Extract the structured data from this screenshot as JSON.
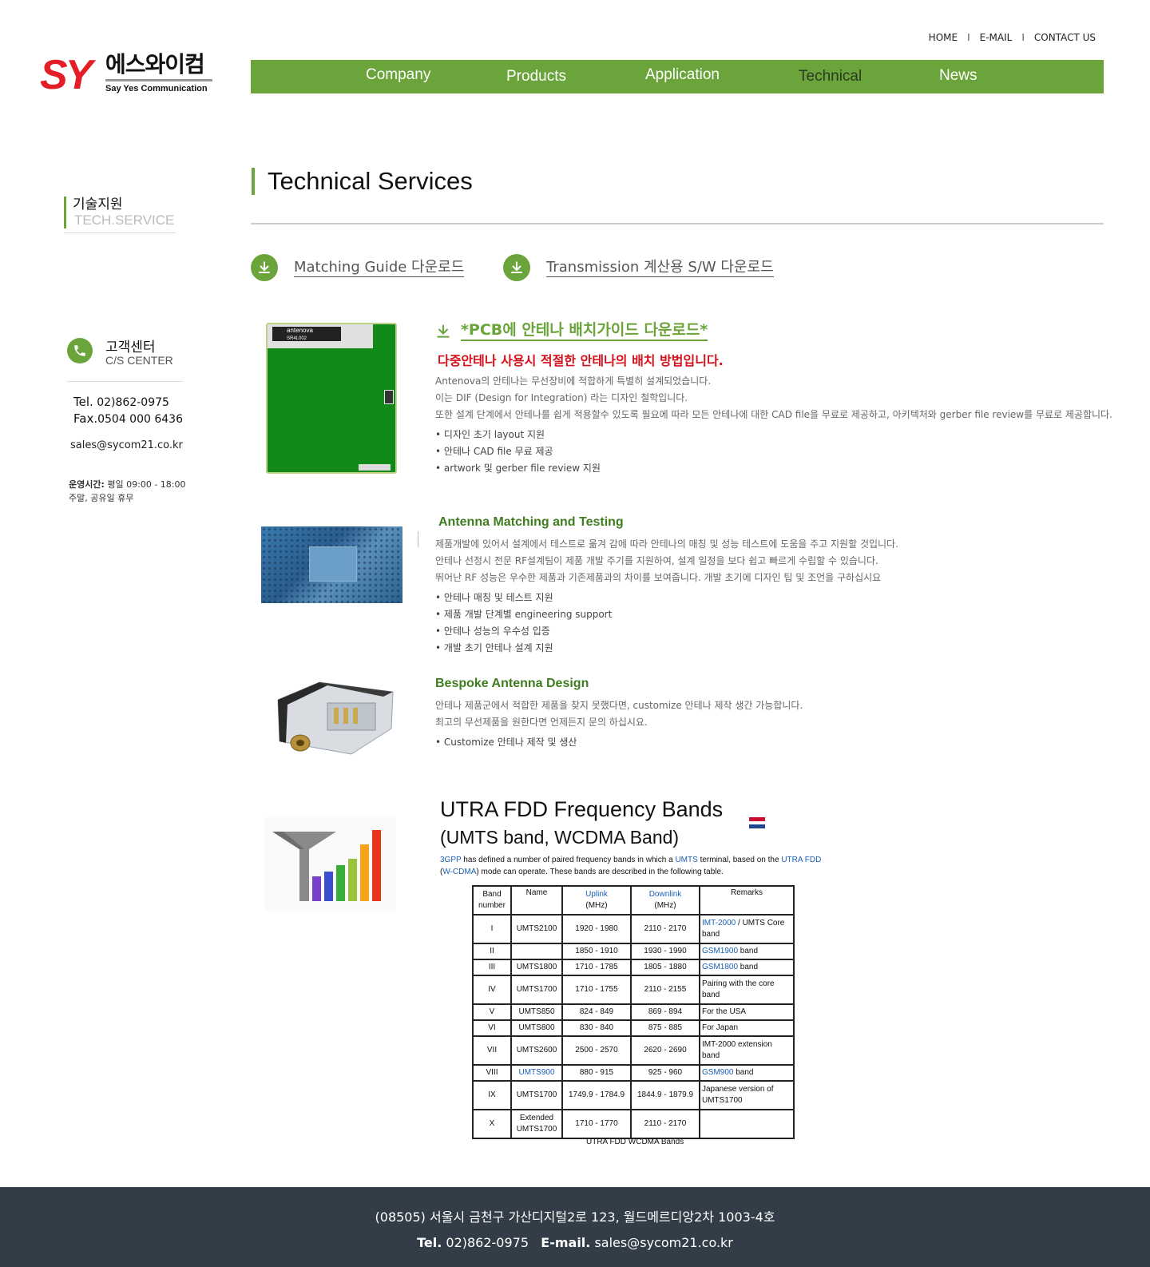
{
  "top_links": [
    "HOME",
    "E-MAIL",
    "CONTACT US"
  ],
  "top_links_sep": "I",
  "logo": {
    "mark": "SY",
    "korean": "에스와이컴",
    "english": "Say Yes Communication"
  },
  "nav": [
    "Company",
    "Products",
    "Application",
    "Technical",
    "News"
  ],
  "nav_active": "Technical",
  "colors": {
    "accent": "#6aa43a",
    "red": "#d4101a",
    "brand_red": "#e41e26",
    "footer": "#333d48"
  },
  "sidebar": {
    "title_ko": "기술지원",
    "title_en": "TECH.SERVICE",
    "cs_ko": "고객센터",
    "cs_en": "C/S CENTER",
    "tel_label": "Tel.",
    "tel": " 02)862-0975",
    "fax_label": "Fax.",
    "fax": "0504 000 6436",
    "email": "sales@sycom21.co.kr",
    "hours_label": "운영시간:",
    "hours": " 평일 09:00 - 18:00",
    "holiday": "주말, 공유일 휴무"
  },
  "page_title": "Technical Services",
  "downloads": [
    "Matching Guide 다운로드",
    "Transmission 계산용 S/W 다운로드"
  ],
  "pcb": {
    "chip_label": "antenova",
    "chip_sub": "SR4L002",
    "link": "*PCB에 안테나 배치가이드 다운로드*",
    "red": "다중안테나 사용시 적절한 안테나의 배치 방법입니다.",
    "paras": [
      "Antenova의 안테나는 무선장비에 적합하게 특별히 설계되었습니다.",
      "이는 DIF (Design for Integration) 라는 디자인 철학입니다.",
      "또한 설계 단계에서 안테나를 쉽게 적용할수 있도록 필요에 따라 모든 안테나에 대한 CAD file을 무료로 제공하고, 아키텍처와 gerber file review를 무료로 제공합니다."
    ],
    "bullets": [
      "디자인 초기 layout 지원",
      "안테나 CAD file 무료 제공",
      "artwork 및 gerber file review 지원"
    ]
  },
  "matching": {
    "title": "Antenna Matching and Testing",
    "paras": [
      "제품개발에 있어서 설계에서 테스트로 옮겨 감에 따라 안테나의 매칭 및 성능 테스트에 도움을 주고 지원할 것입니다.",
      "안테나 선정시 전문 RF설계팀이 제품 개발 주기를 지원하여, 설계 일정을 보다 쉽고 빠르게 수립할 수 있습니다.",
      "뛰어난 RF 성능은 우수한 제품과 기존제품과의 차이를 보여줍니다. 개발 초기에 디자인 팁 및 조언을 구하십시요"
    ],
    "bullets": [
      "안테나 매칭 및 테스트 지원",
      "제품 개발 단계별 engineering support",
      "안테나 성능의 우수성 입증",
      "개발 초기 안테나 설계 지원"
    ]
  },
  "bespoke": {
    "title": "Bespoke Antenna Design",
    "paras": [
      "안테나 제품군에서 적합한 제품을 찾지 못했다면, customize 안테나 제작 생간 가능합니다.",
      "최고의 무선제품을 원한다면 언제든지 문의 하십시요."
    ],
    "bullets": [
      "Customize 안테나 제작 및 생산"
    ]
  },
  "utra": {
    "title1": "UTRA FDD Frequency Bands",
    "title2": "(UMTS band, WCDMA Band)",
    "desc_parts": [
      "3GPP",
      " has defined a number of paired frequency bands in which a ",
      "UMTS",
      " terminal, based on the ",
      "UTRA FDD",
      " (",
      "W-CDMA",
      ") mode can operate. These bands are described in the following table."
    ],
    "headers": [
      "Band number",
      "Name",
      "Uplink",
      "(MHz)",
      "Downlink",
      "(MHz)",
      "Remarks"
    ],
    "rows": [
      {
        "band": "I",
        "name": "UMTS2100",
        "up": "1920 - 1980",
        "down": "2110 - 2170",
        "rem_link": "IMT-2000",
        "rem": " / UMTS Core band"
      },
      {
        "band": "II",
        "name": "",
        "up": "1850 - 1910",
        "down": "1930 - 1990",
        "rem_link": "GSM1900",
        "rem": " band"
      },
      {
        "band": "III",
        "name": "UMTS1800",
        "up": "1710 - 1785",
        "down": "1805 - 1880",
        "rem_link": "GSM1800",
        "rem": " band"
      },
      {
        "band": "IV",
        "name": "UMTS1700",
        "up": "1710 - 1755",
        "down": "2110 - 2155",
        "rem_link": "",
        "rem": "Pairing with the core band"
      },
      {
        "band": "V",
        "name": "UMTS850",
        "up": "824 - 849",
        "down": "869 - 894",
        "rem_link": "",
        "rem": "For the USA"
      },
      {
        "band": "VI",
        "name": "UMTS800",
        "up": "830 - 840",
        "down": "875 - 885",
        "rem_link": "",
        "rem": "For Japan"
      },
      {
        "band": "VII",
        "name": "UMTS2600",
        "up": "2500 - 2570",
        "down": "2620 - 2690",
        "rem_link": "",
        "rem": "IMT-2000 extension band"
      },
      {
        "band": "VIII",
        "name": "UMTS900",
        "up": "880 - 915",
        "down": "925 - 960",
        "rem_link": "GSM900",
        "rem": " band"
      },
      {
        "band": "IX",
        "name": "UMTS1700",
        "up": "1749.9 - 1784.9",
        "down": "1844.9 - 1879.9",
        "rem_link": "",
        "rem": "Japanese version of UMTS1700"
      },
      {
        "band": "X",
        "name": "Extended UMTS1700",
        "up": "1710 - 1770",
        "down": "2110 - 2170",
        "rem_link": "",
        "rem": ""
      }
    ],
    "caption": "UTRA FDD WCDMA Bands"
  },
  "footer": {
    "address": "(08505) 서울시 금천구 가산디지털2로 123, 월드메르디앙2차 1003-4호",
    "tel_label": "Tel.",
    "tel": " 02)862-0975",
    "email_label": "E-mail.",
    "email": " sales@sycom21.co.kr"
  }
}
